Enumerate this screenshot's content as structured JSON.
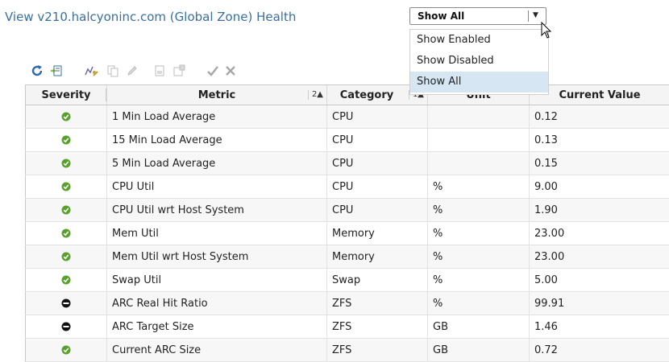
{
  "page": {
    "title": "View v210.halcyoninc.com (Global Zone) Health"
  },
  "filter": {
    "selected": "Show All",
    "options": [
      "Show Enabled",
      "Show Disabled",
      "Show All"
    ]
  },
  "toolbar": {
    "icons": [
      "refresh-icon",
      "export-icon",
      "edit-thresholds-icon",
      "copy-icon",
      "edit-icon",
      "page-icon",
      "page-settings-icon",
      "enable-check-icon",
      "disable-x-icon"
    ]
  },
  "table": {
    "headers": {
      "severity": "Severity",
      "metric": "Metric",
      "metric_sort": "2▲",
      "category": "Category",
      "category_sort": "1▲",
      "unit": "Unit",
      "current_value": "Current Value"
    },
    "rows": [
      {
        "severity": "ok",
        "metric": "1 Min Load Average",
        "category": "CPU",
        "unit": "",
        "value": "0.12"
      },
      {
        "severity": "ok",
        "metric": "15 Min Load Average",
        "category": "CPU",
        "unit": "",
        "value": "0.13"
      },
      {
        "severity": "ok",
        "metric": "5 Min Load Average",
        "category": "CPU",
        "unit": "",
        "value": "0.15"
      },
      {
        "severity": "ok",
        "metric": "CPU Util",
        "category": "CPU",
        "unit": "%",
        "value": "9.00"
      },
      {
        "severity": "ok",
        "metric": "CPU Util wrt Host System",
        "category": "CPU",
        "unit": "%",
        "value": "1.90"
      },
      {
        "severity": "ok",
        "metric": "Mem Util",
        "category": "Memory",
        "unit": "%",
        "value": "23.00"
      },
      {
        "severity": "ok",
        "metric": "Mem Util wrt Host System",
        "category": "Memory",
        "unit": "%",
        "value": "23.00"
      },
      {
        "severity": "ok",
        "metric": "Swap Util",
        "category": "Swap",
        "unit": "%",
        "value": "5.00"
      },
      {
        "severity": "disabled",
        "metric": "ARC Real Hit Ratio",
        "category": "ZFS",
        "unit": "%",
        "value": "99.91"
      },
      {
        "severity": "disabled",
        "metric": "ARC Target Size",
        "category": "ZFS",
        "unit": "GB",
        "value": "1.46"
      },
      {
        "severity": "ok",
        "metric": "Current ARC Size",
        "category": "ZFS",
        "unit": "GB",
        "value": "0.72"
      }
    ]
  },
  "colors": {
    "title": "#3a6fa2",
    "ok": "#5aa02c",
    "disabled": "#111111",
    "selected_option": "#d6e6f2"
  }
}
